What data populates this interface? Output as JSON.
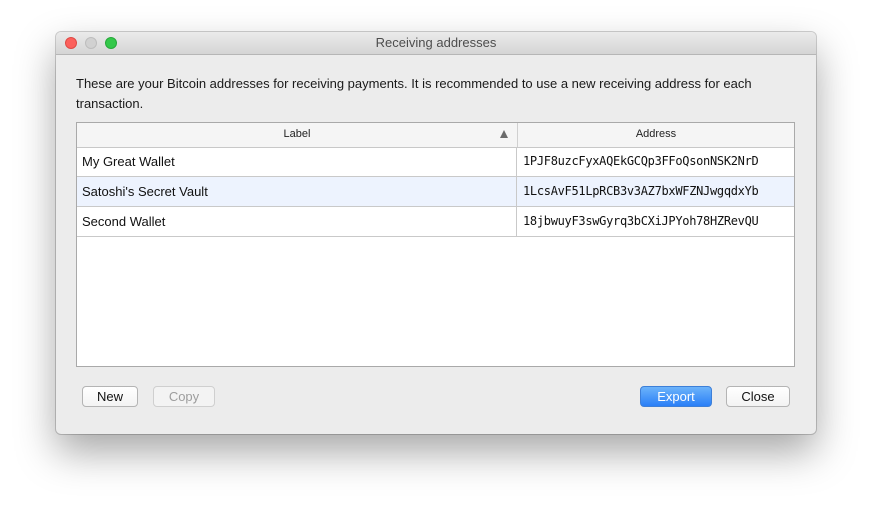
{
  "window": {
    "title": "Receiving addresses"
  },
  "description": "These are your Bitcoin addresses for receiving payments. It is recommended to use a new receiving address for each transaction.",
  "table": {
    "columns": {
      "label": "Label",
      "address": "Address"
    },
    "sort": {
      "column": "Label",
      "icon": "sort-ascending-icon"
    },
    "rows": [
      {
        "label": "My Great Wallet",
        "address": "1PJF8uzcFyxAQEkGCQp3FFoQsonNSK2NrD"
      },
      {
        "label": "Satoshi's Secret Vault",
        "address": "1LcsAvF51LpRCB3v3AZ7bxWFZNJwgqdxYb"
      },
      {
        "label": "Second Wallet",
        "address": "18jbwuyF3swGyrq3bCXiJPYoh78HZRevQU"
      }
    ]
  },
  "buttons": {
    "new": "New",
    "copy": "Copy",
    "export": "Export",
    "close": "Close"
  },
  "colors": {
    "accent": "#2a7ff7",
    "close_dot": "#fc605c",
    "minimize_dot": "#d1d1d1",
    "maximize_dot": "#34c84a",
    "selected_row": "#edf3fe"
  }
}
